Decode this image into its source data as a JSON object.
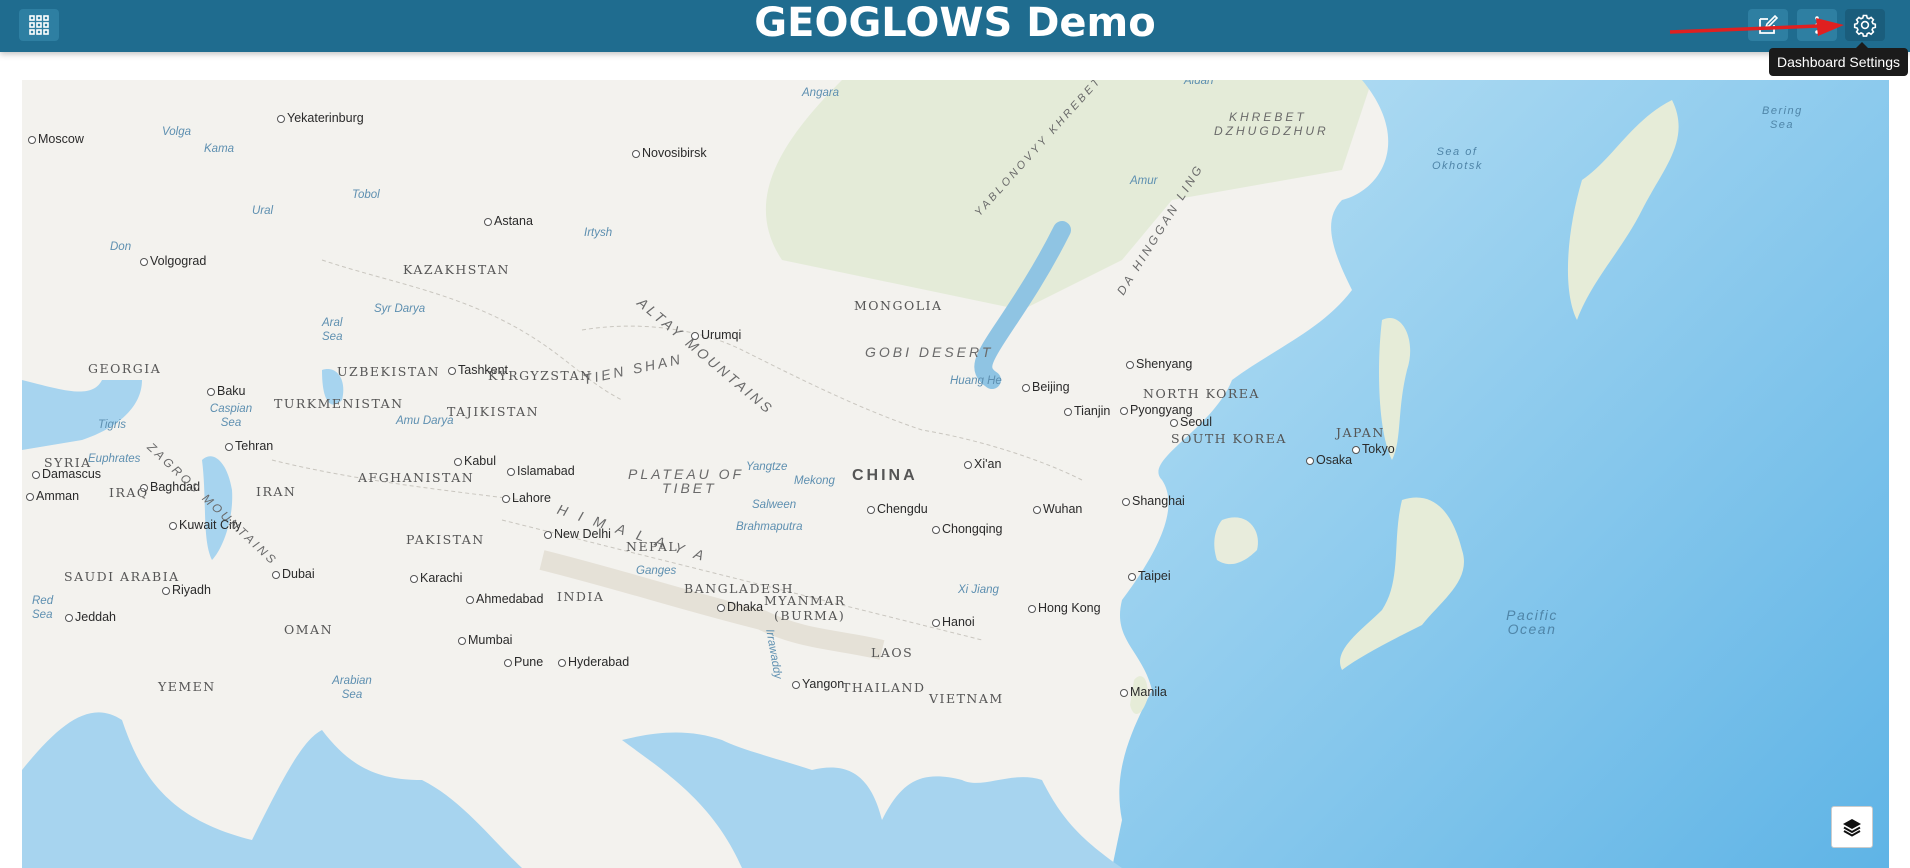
{
  "header": {
    "title": "GEOGLOWS Demo",
    "buttons": [
      {
        "icon": "grid-apps-icon"
      },
      {
        "icon": "edit-icon"
      },
      {
        "icon": "more-vertical-icon"
      },
      {
        "icon": "gear-icon"
      }
    ],
    "tooltip": "Dashboard Settings",
    "accent": "#1f6c8f",
    "annotation_arrow_color": "#e02020"
  },
  "map": {
    "land_color": "#f3f2ee",
    "water_color": "#a7d4ef",
    "layers_icon": "layers-icon",
    "labels": [
      {
        "text": "Moscow",
        "kind": "city"
      },
      {
        "text": "Yekaterinburg",
        "kind": "city"
      },
      {
        "text": "Novosibirsk",
        "kind": "city"
      },
      {
        "text": "Astana",
        "kind": "city"
      },
      {
        "text": "Volgograd",
        "kind": "city"
      },
      {
        "text": "Baku",
        "kind": "city"
      },
      {
        "text": "Tashkent",
        "kind": "city"
      },
      {
        "text": "Urumqi",
        "kind": "city"
      },
      {
        "text": "Tehran",
        "kind": "city"
      },
      {
        "text": "Kabul",
        "kind": "city"
      },
      {
        "text": "Islamabad",
        "kind": "city"
      },
      {
        "text": "Lahore",
        "kind": "city"
      },
      {
        "text": "New Delhi",
        "kind": "city"
      },
      {
        "text": "Damascus",
        "kind": "city"
      },
      {
        "text": "Amman",
        "kind": "city"
      },
      {
        "text": "Baghdad",
        "kind": "city"
      },
      {
        "text": "Kuwait City",
        "kind": "city"
      },
      {
        "text": "Riyadh",
        "kind": "city"
      },
      {
        "text": "Jeddah",
        "kind": "city"
      },
      {
        "text": "Dubai",
        "kind": "city"
      },
      {
        "text": "Karachi",
        "kind": "city"
      },
      {
        "text": "Ahmedabad",
        "kind": "city"
      },
      {
        "text": "Mumbai",
        "kind": "city"
      },
      {
        "text": "Pune",
        "kind": "city"
      },
      {
        "text": "Hyderabad",
        "kind": "city"
      },
      {
        "text": "Dhaka",
        "kind": "city"
      },
      {
        "text": "Chengdu",
        "kind": "city"
      },
      {
        "text": "Chongqing",
        "kind": "city"
      },
      {
        "text": "Xi'an",
        "kind": "city"
      },
      {
        "text": "Wuhan",
        "kind": "city"
      },
      {
        "text": "Shanghai",
        "kind": "city"
      },
      {
        "text": "Beijing",
        "kind": "city"
      },
      {
        "text": "Tianjin",
        "kind": "city"
      },
      {
        "text": "Shenyang",
        "kind": "city"
      },
      {
        "text": "Pyongyang",
        "kind": "city"
      },
      {
        "text": "Seoul",
        "kind": "city"
      },
      {
        "text": "Osaka",
        "kind": "city"
      },
      {
        "text": "Tokyo",
        "kind": "city"
      },
      {
        "text": "Taipei",
        "kind": "city"
      },
      {
        "text": "Hong Kong",
        "kind": "city"
      },
      {
        "text": "Hanoi",
        "kind": "city"
      },
      {
        "text": "Yangon",
        "kind": "city"
      },
      {
        "text": "Manila",
        "kind": "city"
      },
      {
        "text": "KAZAKHSTAN",
        "kind": "country"
      },
      {
        "text": "MONGOLIA",
        "kind": "country"
      },
      {
        "text": "UZBEKISTAN",
        "kind": "country"
      },
      {
        "text": "TURKMENISTAN",
        "kind": "country"
      },
      {
        "text": "KYRGYZSTAN",
        "kind": "country"
      },
      {
        "text": "TAJIKISTAN",
        "kind": "country"
      },
      {
        "text": "GEORGIA",
        "kind": "country"
      },
      {
        "text": "AFGHANISTAN",
        "kind": "country"
      },
      {
        "text": "IRAN",
        "kind": "country"
      },
      {
        "text": "IRAQ",
        "kind": "country"
      },
      {
        "text": "SYRIA",
        "kind": "country"
      },
      {
        "text": "PAKISTAN",
        "kind": "country"
      },
      {
        "text": "INDIA",
        "kind": "country"
      },
      {
        "text": "NEPAL",
        "kind": "country"
      },
      {
        "text": "SAUDI ARABIA",
        "kind": "country"
      },
      {
        "text": "OMAN",
        "kind": "country"
      },
      {
        "text": "YEMEN",
        "kind": "country"
      },
      {
        "text": "BANGLADESH",
        "kind": "country"
      },
      {
        "text": "MYANMAR",
        "kind": "country"
      },
      {
        "text": "(BURMA)",
        "kind": "country"
      },
      {
        "text": "LAOS",
        "kind": "country"
      },
      {
        "text": "THAILAND",
        "kind": "country"
      },
      {
        "text": "VIETNAM",
        "kind": "country"
      },
      {
        "text": "NORTH KOREA",
        "kind": "country"
      },
      {
        "text": "SOUTH KOREA",
        "kind": "country"
      },
      {
        "text": "JAPAN",
        "kind": "country"
      },
      {
        "text": "CHINA",
        "kind": "major"
      },
      {
        "text": "ALTAY MOUNTAINS",
        "kind": "physical"
      },
      {
        "text": "GOBI DESERT",
        "kind": "physical"
      },
      {
        "text": "TIEN SHAN",
        "kind": "physical"
      },
      {
        "text": "PLATEAU OF",
        "kind": "physical"
      },
      {
        "text": "TIBET",
        "kind": "physical"
      },
      {
        "text": "HIMALAYA",
        "kind": "physical"
      },
      {
        "text": "ZAGROS MOUNTAINS",
        "kind": "physical"
      },
      {
        "text": "YABLONOVYY KHREBET",
        "kind": "physical"
      },
      {
        "text": "DA HINGGAN LING",
        "kind": "physical"
      },
      {
        "text": "KHREBET",
        "kind": "physical"
      },
      {
        "text": "DZHUGDZHUR",
        "kind": "physical"
      },
      {
        "text": "Volga",
        "kind": "water"
      },
      {
        "text": "Kama",
        "kind": "water"
      },
      {
        "text": "Tobol",
        "kind": "water"
      },
      {
        "text": "Ural",
        "kind": "water"
      },
      {
        "text": "Don",
        "kind": "water"
      },
      {
        "text": "Irtysh",
        "kind": "water"
      },
      {
        "text": "Syr Darya",
        "kind": "water"
      },
      {
        "text": "Aral Sea",
        "kind": "water"
      },
      {
        "text": "Caspian Sea",
        "kind": "water"
      },
      {
        "text": "Amu Darya",
        "kind": "water"
      },
      {
        "text": "Angara",
        "kind": "water"
      },
      {
        "text": "Aldan",
        "kind": "water"
      },
      {
        "text": "Amur",
        "kind": "water"
      },
      {
        "text": "Huang He",
        "kind": "water"
      },
      {
        "text": "Yangtze",
        "kind": "water"
      },
      {
        "text": "Mekong",
        "kind": "water"
      },
      {
        "text": "Salween",
        "kind": "water"
      },
      {
        "text": "Brahmaputra",
        "kind": "water"
      },
      {
        "text": "Ganges",
        "kind": "water"
      },
      {
        "text": "Xi Jiang",
        "kind": "water"
      },
      {
        "text": "Euphrates",
        "kind": "water"
      },
      {
        "text": "Tigris",
        "kind": "water"
      },
      {
        "text": "Irrawaddy",
        "kind": "water"
      },
      {
        "text": "Red Sea",
        "kind": "water"
      },
      {
        "text": "Arabian Sea",
        "kind": "water"
      },
      {
        "text": "Sea of Okhotsk",
        "kind": "ocean"
      },
      {
        "text": "Bering Sea",
        "kind": "ocean"
      },
      {
        "text": "Pacific Ocean",
        "kind": "ocean"
      }
    ]
  }
}
